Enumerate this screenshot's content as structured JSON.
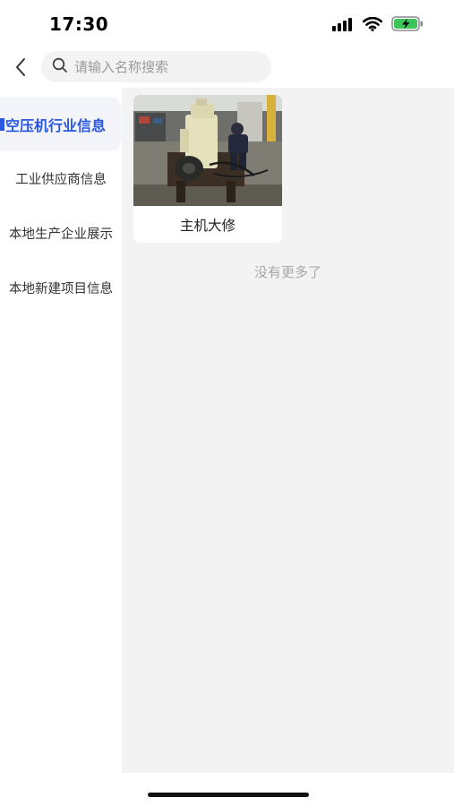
{
  "status_bar": {
    "time": "17:30",
    "icons": [
      "signal-icon",
      "wifi-icon",
      "battery-charging-icon"
    ]
  },
  "nav": {
    "back_icon": "chevron-left-icon",
    "search_icon": "search-icon",
    "search_placeholder": "请输入名称搜索",
    "search_value": ""
  },
  "sidebar": {
    "items": [
      {
        "label": "空压机行业信息",
        "active": true
      },
      {
        "label": "工业供应商信息",
        "active": false
      },
      {
        "label": "本地生产企业展示",
        "active": false
      },
      {
        "label": "本地新建项目信息",
        "active": false
      }
    ]
  },
  "content": {
    "cards": [
      {
        "title": "主机大修",
        "image": "machine-photo"
      }
    ],
    "footer_text": "没有更多了"
  },
  "colors": {
    "accent": "#2a56e0",
    "content_bg": "#f3f3f3",
    "sidebar_active_bg": "#f3f5fa"
  }
}
